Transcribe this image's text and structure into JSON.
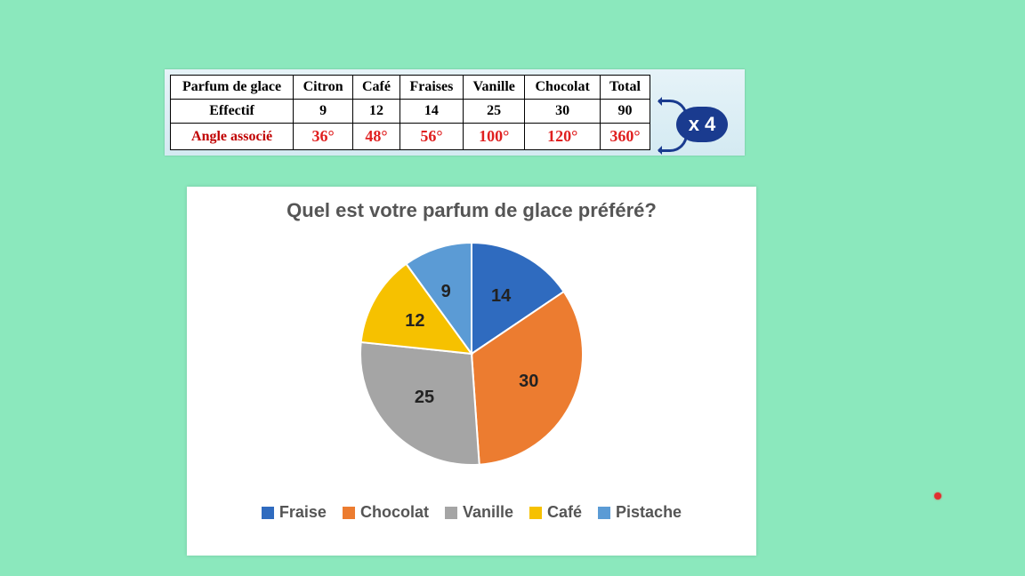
{
  "table": {
    "headers": [
      "Parfum de glace",
      "Citron",
      "Café",
      "Fraises",
      "Vanille",
      "Chocolat",
      "Total"
    ],
    "rows": [
      {
        "label": "Effectif",
        "cells": [
          "9",
          "12",
          "14",
          "25",
          "30",
          "90"
        ],
        "cls": ""
      },
      {
        "label": "Angle associé",
        "cells": [
          "36°",
          "48°",
          "56°",
          "100°",
          "120°",
          "360°"
        ],
        "cls": "angle"
      }
    ]
  },
  "badge": "x 4",
  "chart_data": {
    "type": "pie",
    "title": "Quel est votre parfum de glace préféré?",
    "series": [
      {
        "name": "Fraise",
        "value": 14,
        "color": "#2f6bbf"
      },
      {
        "name": "Chocolat",
        "value": 30,
        "color": "#ec7c30"
      },
      {
        "name": "Vanille",
        "value": 25,
        "color": "#a5a5a5"
      },
      {
        "name": "Café",
        "value": 12,
        "color": "#f6c100"
      },
      {
        "name": "Pistache",
        "value": 9,
        "color": "#5b9bd5"
      }
    ],
    "legend": [
      "Fraise",
      "Chocolat",
      "Vanille",
      "Café",
      "Pistache"
    ]
  }
}
